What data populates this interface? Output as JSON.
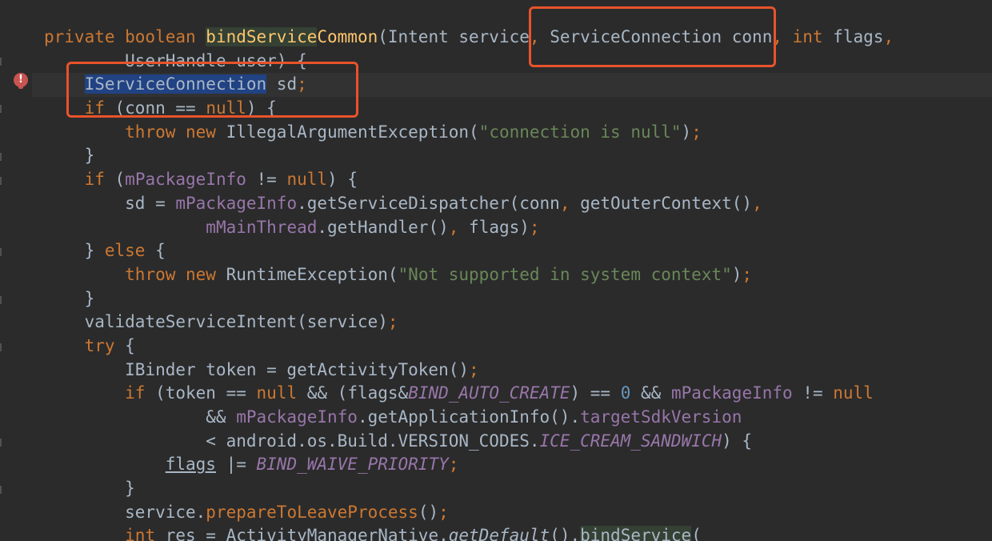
{
  "editor": {
    "warning_icon_glyph": "!",
    "colors": {
      "background": "#2b2b2b",
      "keyword": "#cc7832",
      "method_declaration": "#ffc66d",
      "string": "#6a8759",
      "number": "#6897bb",
      "field": "#9876aa",
      "default_text": "#a9b7c6",
      "callout_border": "#e8532b"
    },
    "lines": [
      [
        {
          "t": "private boolean ",
          "c": "kw"
        },
        {
          "t": "bindService",
          "c": "fn hl-green"
        },
        {
          "t": "Common",
          "c": "fn"
        },
        {
          "t": "(Intent service",
          "c": ""
        },
        {
          "t": ", ",
          "c": "kw"
        },
        {
          "t": "ServiceConnection conn",
          "c": ""
        },
        {
          "t": ", ",
          "c": "kw"
        },
        {
          "t": "int ",
          "c": "kw"
        },
        {
          "t": "flags",
          "c": ""
        },
        {
          "t": ",",
          "c": "kw"
        }
      ],
      [
        {
          "t": "        UserHandle user) {",
          "c": ""
        }
      ],
      [
        {
          "t": "    ",
          "c": ""
        },
        {
          "t": "IServiceConnection",
          "c": "hl-sel"
        },
        {
          "t": " sd",
          "c": ""
        },
        {
          "t": ";",
          "c": "kw"
        }
      ],
      [
        {
          "t": "    ",
          "c": ""
        },
        {
          "t": "if ",
          "c": "kw"
        },
        {
          "t": "(conn == ",
          "c": ""
        },
        {
          "t": "null",
          "c": "kw"
        },
        {
          "t": ") {",
          "c": ""
        }
      ],
      [
        {
          "t": "        ",
          "c": ""
        },
        {
          "t": "throw new ",
          "c": "kw"
        },
        {
          "t": "IllegalArgumentException(",
          "c": ""
        },
        {
          "t": "\"connection is null\"",
          "c": "str"
        },
        {
          "t": ")",
          "c": ""
        },
        {
          "t": ";",
          "c": "kw"
        }
      ],
      [
        {
          "t": "    }",
          "c": ""
        }
      ],
      [
        {
          "t": "    ",
          "c": ""
        },
        {
          "t": "if ",
          "c": "kw"
        },
        {
          "t": "(",
          "c": ""
        },
        {
          "t": "mPackageInfo",
          "c": "fld"
        },
        {
          "t": " != ",
          "c": ""
        },
        {
          "t": "null",
          "c": "kw"
        },
        {
          "t": ") {",
          "c": ""
        }
      ],
      [
        {
          "t": "        sd = ",
          "c": ""
        },
        {
          "t": "mPackageInfo",
          "c": "fld"
        },
        {
          "t": ".getServiceDispatcher(conn",
          "c": ""
        },
        {
          "t": ", ",
          "c": "kw"
        },
        {
          "t": "getOuterContext()",
          "c": ""
        },
        {
          "t": ",",
          "c": "kw"
        }
      ],
      [
        {
          "t": "                ",
          "c": ""
        },
        {
          "t": "mMainThread",
          "c": "fld"
        },
        {
          "t": ".getHandler()",
          "c": ""
        },
        {
          "t": ", ",
          "c": "kw"
        },
        {
          "t": "flags)",
          "c": ""
        },
        {
          "t": ";",
          "c": "kw"
        }
      ],
      [
        {
          "t": "    } ",
          "c": ""
        },
        {
          "t": "else ",
          "c": "kw"
        },
        {
          "t": "{",
          "c": ""
        }
      ],
      [
        {
          "t": "        ",
          "c": ""
        },
        {
          "t": "throw new ",
          "c": "kw"
        },
        {
          "t": "RuntimeException(",
          "c": ""
        },
        {
          "t": "\"Not supported in system context\"",
          "c": "str"
        },
        {
          "t": ")",
          "c": ""
        },
        {
          "t": ";",
          "c": "kw"
        }
      ],
      [
        {
          "t": "    }",
          "c": ""
        }
      ],
      [
        {
          "t": "    validateServiceIntent(service)",
          "c": ""
        },
        {
          "t": ";",
          "c": "kw"
        }
      ],
      [
        {
          "t": "    ",
          "c": ""
        },
        {
          "t": "try ",
          "c": "kw"
        },
        {
          "t": "{",
          "c": ""
        }
      ],
      [
        {
          "t": "        IBinder token = getActivityToken()",
          "c": ""
        },
        {
          "t": ";",
          "c": "kw"
        }
      ],
      [
        {
          "t": "        ",
          "c": ""
        },
        {
          "t": "if ",
          "c": "kw"
        },
        {
          "t": "(token == ",
          "c": ""
        },
        {
          "t": "null ",
          "c": "kw"
        },
        {
          "t": "&& (flags&",
          "c": ""
        },
        {
          "t": "BIND_AUTO_CREATE",
          "c": "sfld"
        },
        {
          "t": ") == ",
          "c": ""
        },
        {
          "t": "0 ",
          "c": "num"
        },
        {
          "t": "&& ",
          "c": ""
        },
        {
          "t": "mPackageInfo",
          "c": "fld"
        },
        {
          "t": " != ",
          "c": ""
        },
        {
          "t": "null",
          "c": "kw"
        }
      ],
      [
        {
          "t": "                && ",
          "c": ""
        },
        {
          "t": "mPackageInfo",
          "c": "fld"
        },
        {
          "t": ".getApplicationInfo().",
          "c": ""
        },
        {
          "t": "targetSdkVersion",
          "c": "fld"
        }
      ],
      [
        {
          "t": "                < android.os.Build.VERSION_CODES.",
          "c": ""
        },
        {
          "t": "ICE_CREAM_SANDWICH",
          "c": "sfld"
        },
        {
          "t": ") {",
          "c": ""
        }
      ],
      [
        {
          "t": "            ",
          "c": ""
        },
        {
          "t": "flags",
          "c": "ul"
        },
        {
          "t": " |= ",
          "c": ""
        },
        {
          "t": "BIND_WAIVE_PRIORITY",
          "c": "sfld"
        },
        {
          "t": ";",
          "c": "kw"
        }
      ],
      [
        {
          "t": "        }",
          "c": ""
        }
      ],
      [
        {
          "t": "        service.",
          "c": ""
        },
        {
          "t": "prepareToLeaveProcess",
          "c": "kw"
        },
        {
          "t": "()",
          "c": ""
        },
        {
          "t": ";",
          "c": "kw"
        }
      ],
      [
        {
          "t": "        ",
          "c": ""
        },
        {
          "t": "int ",
          "c": "kw"
        },
        {
          "t": "res = ActivityManagerNative.",
          "c": ""
        },
        {
          "t": "getDefault",
          "c": "it"
        },
        {
          "t": "().",
          "c": ""
        },
        {
          "t": "bindService",
          "c": "hl-green"
        },
        {
          "t": "(",
          "c": ""
        }
      ]
    ]
  }
}
